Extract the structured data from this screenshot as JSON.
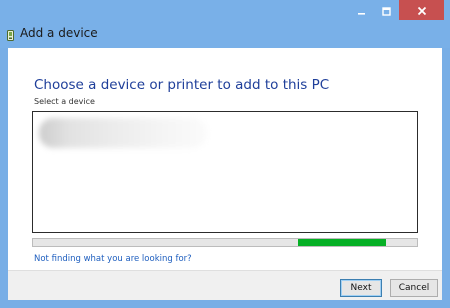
{
  "window": {
    "title": "Add a device",
    "icon": "add-device-icon",
    "controls": {
      "minimize": "minimize-icon",
      "maximize": "maximize-icon",
      "close": "close-icon"
    },
    "close_color": "#c75050",
    "frame_color": "#79b0e8"
  },
  "main": {
    "heading": "Choose a device or printer to add to this PC",
    "subheading": "Select a device",
    "device_list": {
      "items": [
        {
          "label": "",
          "icon": "blurred-device-entry"
        }
      ]
    },
    "progress": {
      "indeterminate": true,
      "segment_start": 0.69,
      "segment_end": 0.92,
      "color": "#06b025"
    },
    "help_link": "Not finding what you are looking for?"
  },
  "footer": {
    "next_label": "Next",
    "cancel_label": "Cancel"
  }
}
